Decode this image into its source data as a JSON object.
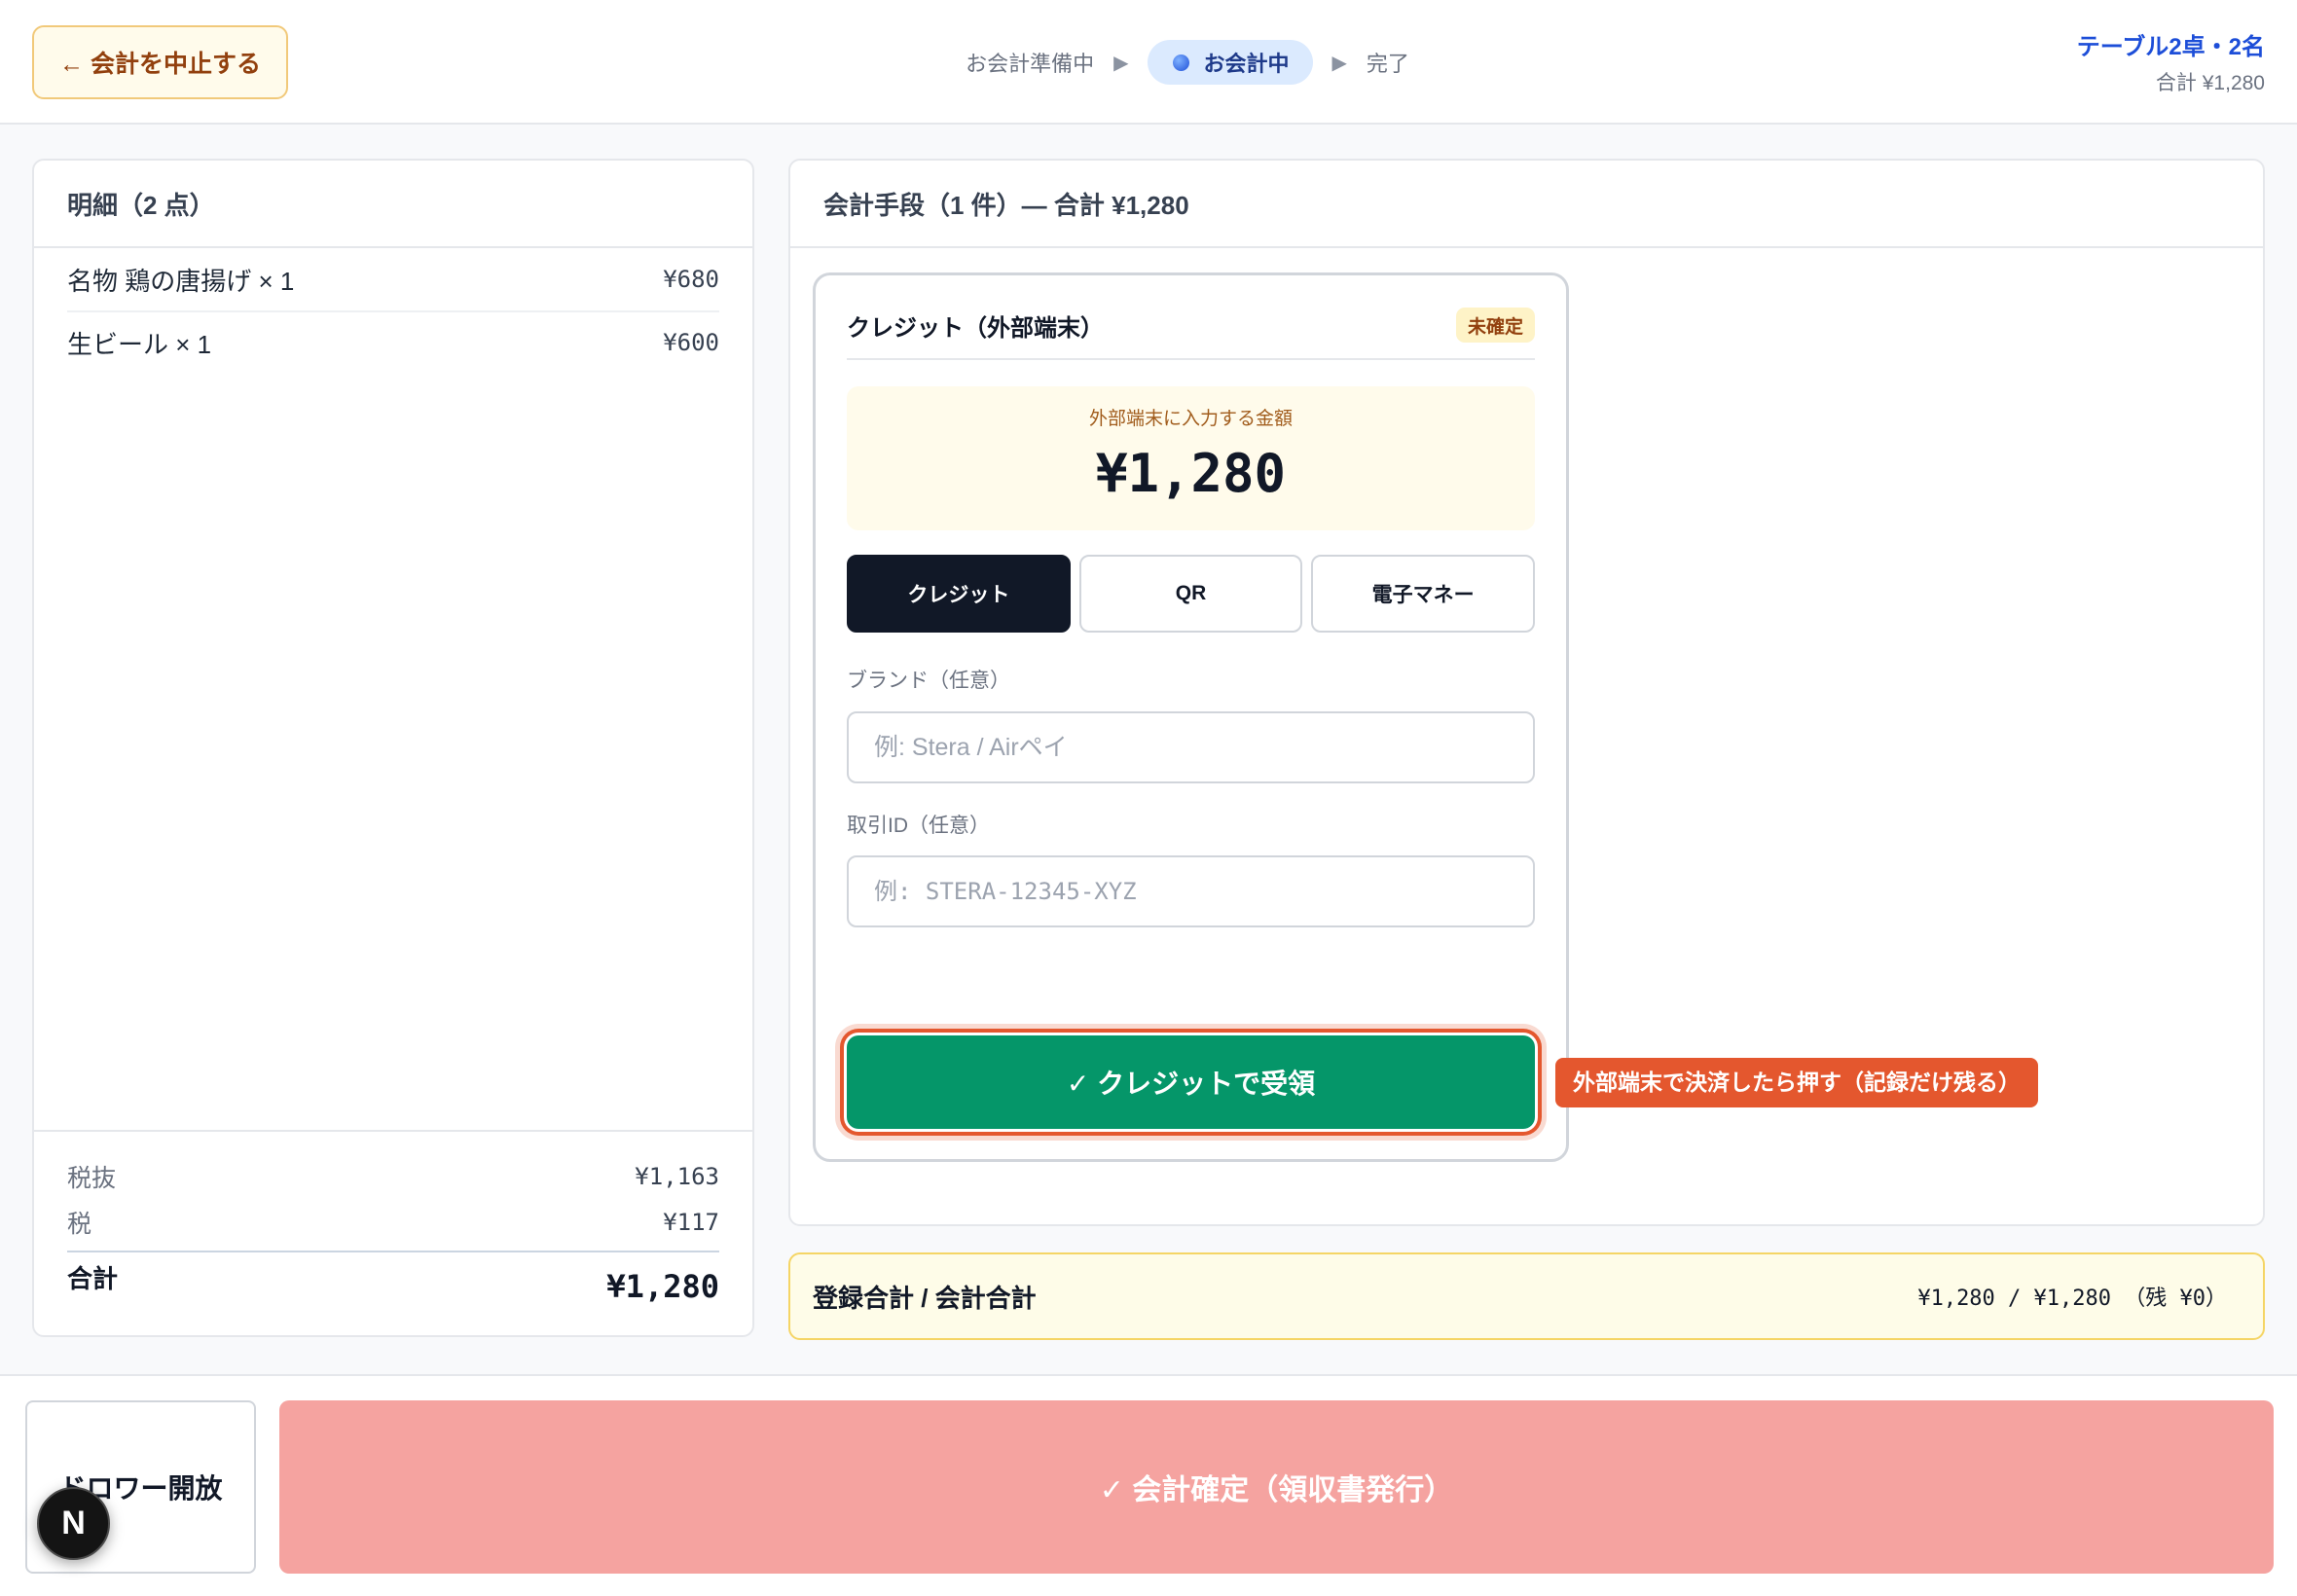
{
  "colors": {
    "accent": "#1d4ed8",
    "success": "#059669",
    "highlight": "#e4572e",
    "confirm": "#f5a3a0",
    "dark": "#111827",
    "warn_bg": "#fffbeb"
  },
  "header": {
    "cancel_label": "← 会計を中止する",
    "steps": [
      {
        "label": "お会計準備中",
        "current": false
      },
      {
        "label": "お会計中",
        "current": true
      },
      {
        "label": "完了",
        "current": false
      }
    ],
    "step_separator": "▶",
    "table_label": "テーブル2卓・2名",
    "total_label": "合計 ¥1,280"
  },
  "receipt": {
    "title": "明細（2 点）",
    "items": [
      {
        "name": "名物 鶏の唐揚げ × 1",
        "price": "¥680"
      },
      {
        "name": "生ビール × 1",
        "price": "¥600"
      }
    ],
    "subtotal_label": "税抜",
    "subtotal": "¥1,163",
    "tax_label": "税",
    "tax": "¥117",
    "total_label": "合計",
    "total": "¥1,280"
  },
  "payments": {
    "title": "会計手段（1 件）— 合計 ¥1,280",
    "card": {
      "title": "クレジット（外部端末）",
      "status": "未確定",
      "amount_label": "外部端末に入力する金額",
      "amount": "¥1,280",
      "methods": [
        {
          "label": "クレジット",
          "selected": true
        },
        {
          "label": "QR",
          "selected": false
        },
        {
          "label": "電子マネー",
          "selected": false
        }
      ],
      "brand": {
        "label": "ブランド（任意）",
        "placeholder": "例: Stera / Airペイ",
        "value": ""
      },
      "transaction_id": {
        "label": "取引ID（任意）",
        "placeholder": "例: STERA-12345-XYZ",
        "value": ""
      },
      "receive_label": "✓ クレジットで受領"
    },
    "hint": "外部端末で決済したら押す（記録だけ残る）"
  },
  "summary": {
    "label": "登録合計 / 会計合計",
    "value": "¥1,280 / ¥1,280 （残 ¥0）"
  },
  "footer": {
    "drawer_label": "ドロワー開放",
    "confirm_label": "✓ 会計確定（領収書発行）"
  },
  "dev_indicator": {
    "logo": "N"
  }
}
